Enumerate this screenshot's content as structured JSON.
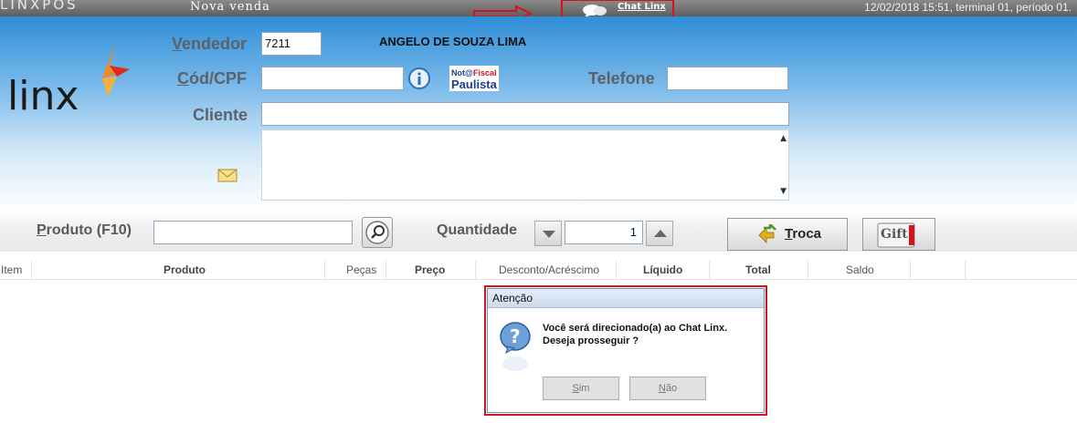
{
  "topbar": {
    "brand": "LINXPOS",
    "module": "Nova venda",
    "chat_link": "Chat Linx",
    "status": "12/02/2018 15:51, terminal 01, período 01."
  },
  "form": {
    "logo": "linx",
    "vendedor_label_u": "V",
    "vendedor_label_rest": "endedor",
    "vendedor_code": "7211",
    "vendedor_name": "ANGELO DE SOUZA LIMA",
    "cpf_label_u": "C",
    "cpf_label_rest": "ód/CPF",
    "cpf_value": "",
    "nota_fiscal_badge": "Nota Fiscal Paulista",
    "telefone_label": "Telefone",
    "telefone_value": "",
    "cliente_label": "Cliente",
    "cliente_value": ""
  },
  "product_row": {
    "produto_label_u": "P",
    "produto_label_rest": "roduto (F10)",
    "produto_value": "",
    "quantidade_label": "Quantidade",
    "quantidade_value": "1",
    "troca_label_u": "T",
    "troca_label_rest": "roca",
    "gift_label": "Gift"
  },
  "table": {
    "columns": [
      "Item",
      "Produto",
      "Peças",
      "Preço",
      "Desconto/Acréscimo",
      "Líquido",
      "Total",
      "Saldo"
    ]
  },
  "dialog": {
    "title": "Atenção",
    "line1": "Você será direcionado(a) ao Chat Linx.",
    "line2": "Deseja prosseguir ?",
    "sim_u": "S",
    "sim_rest": "im",
    "nao_u": "N",
    "nao_rest": "ão"
  },
  "colors": {
    "accent_red": "#d4141c",
    "header_blue": "#2f8ed8",
    "logo_orange": "#f08a1c"
  }
}
